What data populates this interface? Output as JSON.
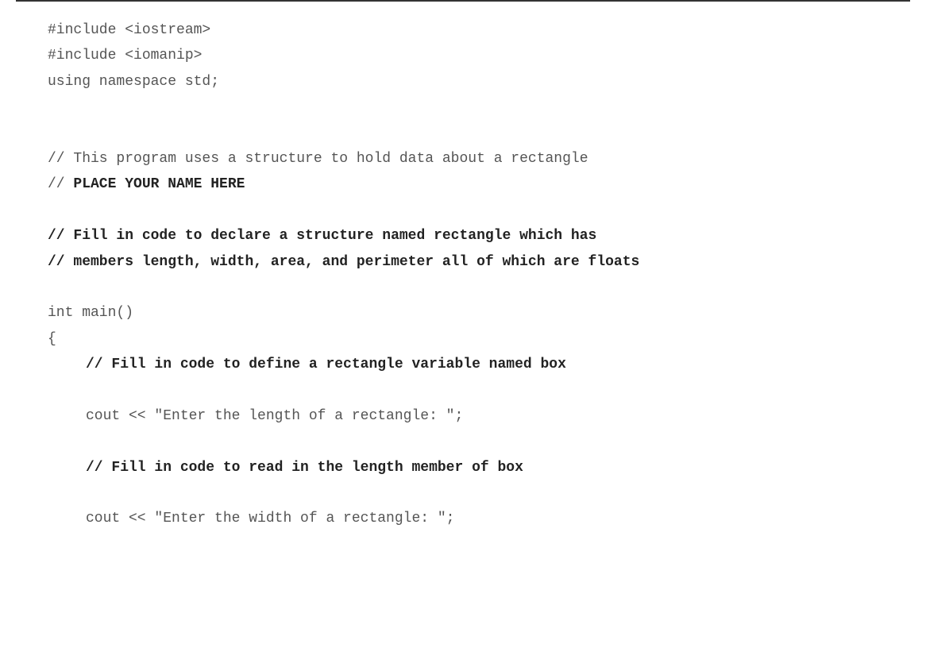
{
  "code": {
    "line1": "#include <iostream>",
    "line2": "#include <iomanip>",
    "line3": "using namespace std;",
    "line4": "// This program uses a structure to hold data about a rectangle",
    "line5_prefix": "// ",
    "line5_bold": "PLACE YOUR NAME HERE",
    "line6": "// Fill in code to declare a structure named rectangle which has",
    "line7": "// members length, width, area, and perimeter all of which are floats",
    "line8": "int main()",
    "line9": "{",
    "line10": "// Fill in code to define a rectangle variable named box",
    "line11": "cout << \"Enter the length of a rectangle: \";",
    "line12": "// Fill in code to read in the length member of box",
    "line13": "cout << \"Enter the width of a rectangle: \";"
  }
}
